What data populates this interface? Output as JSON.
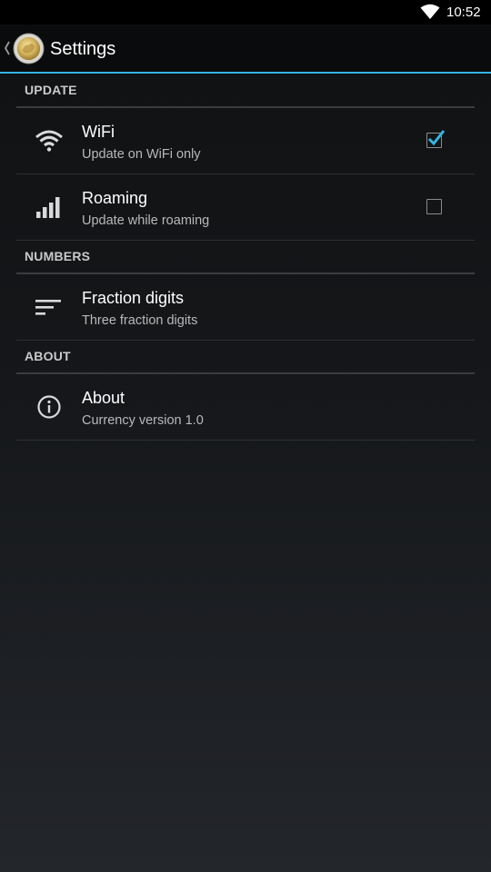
{
  "status_bar": {
    "time": "10:52",
    "wifi_icon": "wifi-icon"
  },
  "action_bar": {
    "title": "Settings",
    "up_icon": "chevron-left-icon",
    "app_icon": "coin-icon",
    "accent_color": "#33b5e5"
  },
  "sections": {
    "update": {
      "label": "UPDATE",
      "wifi": {
        "title": "WiFi",
        "summary": "Update on WiFi only",
        "icon": "wifi-icon",
        "checked": true
      },
      "roaming": {
        "title": "Roaming",
        "summary": "Update while roaming",
        "icon": "signal-bars-icon",
        "checked": false
      }
    },
    "numbers": {
      "label": "NUMBERS",
      "fraction": {
        "title": "Fraction digits",
        "summary": "Three fraction digits",
        "icon": "sort-lines-icon"
      }
    },
    "about": {
      "label": "ABOUT",
      "about": {
        "title": "About",
        "summary": "Currency version 1.0",
        "icon": "info-icon"
      }
    }
  }
}
